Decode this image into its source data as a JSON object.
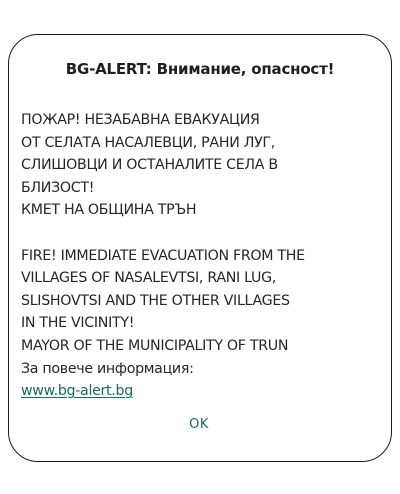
{
  "dialog": {
    "title": "BG-ALERT: Внимание, опасност!",
    "message_bg": [
      "ПОЖАР! НЕЗАБАВНА ЕВАКУАЦИЯ",
      "ОТ СЕЛАТА НАСАЛЕВЦИ, РАНИ ЛУГ,",
      "СЛИШОВЦИ И ОСТАНАЛИТЕ СЕЛА В",
      "БЛИЗОСТ!",
      "КМЕТ НА ОБЩИНА ТРЪН"
    ],
    "message_en": [
      "FIRE! IMMEDIATE EVACUATION FROM THE",
      "VILLAGES OF NASALEVTSI, RANI LUG,",
      "SLISHOVTSI AND THE OTHER VILLAGES",
      "IN THE VICINITY!",
      "MAYOR OF THE MUNICIPALITY OF TRUN"
    ],
    "more_info_label": "За повече информация:",
    "link_text": "www.bg-alert.bg",
    "ok_label": "OK"
  },
  "colors": {
    "accent": "#1b6b5c",
    "text": "#262626",
    "border": "#1a1a1a"
  }
}
